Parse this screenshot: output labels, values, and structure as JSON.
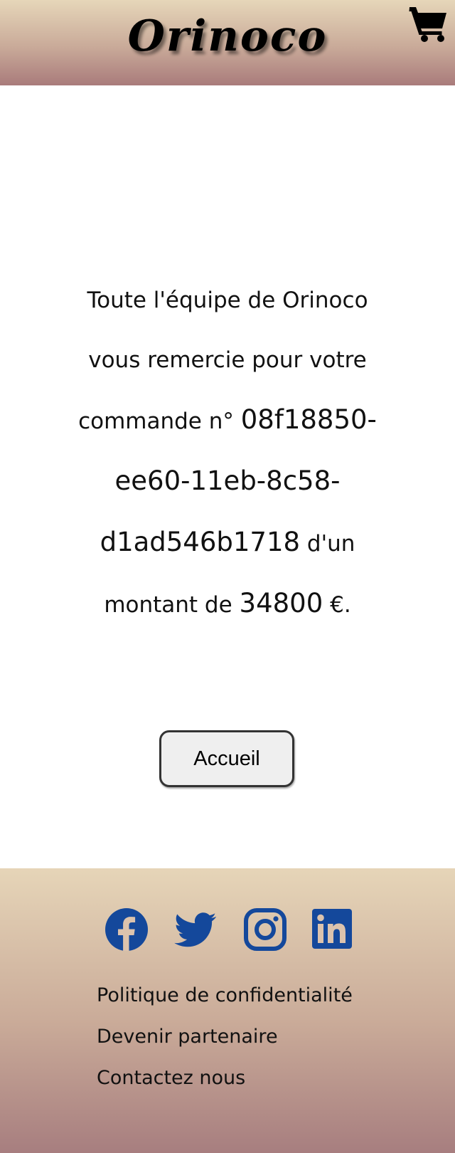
{
  "header": {
    "logo": "Orinoco",
    "cart_icon": "shopping-cart-icon"
  },
  "confirmation": {
    "line_1": "Toute l'équipe de Orinoco",
    "line_2": "vous remercie pour votre",
    "line_3_prefix": "commande n° ",
    "order_id_part1": "08f18850-",
    "order_id_part2": "ee60-11eb-8c58-",
    "order_id_part3": "d1ad546b1718",
    "line_5_suffix": " d'un",
    "amount_prefix": "montant de ",
    "amount": "34800",
    "currency": " €."
  },
  "home_button": {
    "label": "Accueil"
  },
  "footer": {
    "social_icons": [
      "facebook-icon",
      "twitter-icon",
      "instagram-icon",
      "linkedin-icon"
    ],
    "social_color": "#14489b",
    "links": [
      "Politique de confidentialité",
      "Devenir partenaire",
      "Contactez nous"
    ]
  }
}
